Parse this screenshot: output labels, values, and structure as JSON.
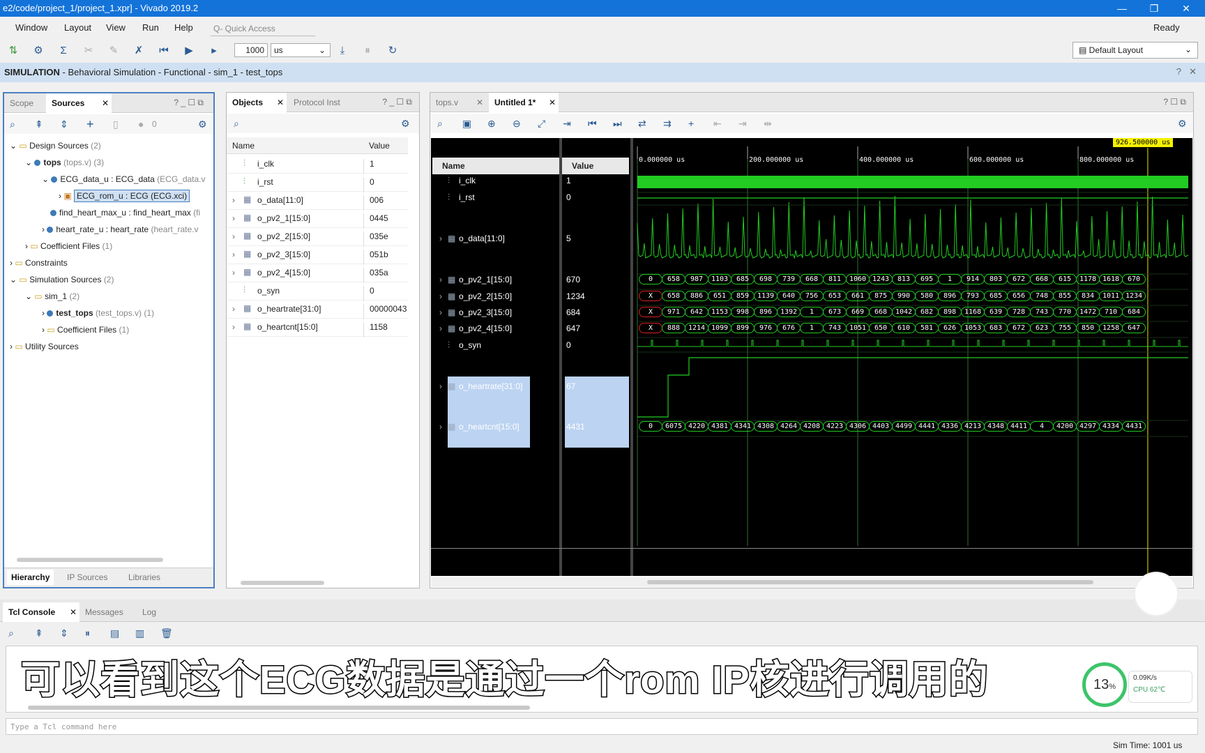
{
  "window": {
    "title": "e2/code/project_1/project_1.xpr] - Vivado 2019.2",
    "controls": [
      "—",
      "❐",
      "✕"
    ]
  },
  "menu": {
    "items": [
      "Window",
      "Layout",
      "View",
      "Run",
      "Help"
    ],
    "quick_access_placeholder": "Q- Quick Access",
    "status": "Ready"
  },
  "toolbar": {
    "time_value": "1000",
    "time_unit": "us",
    "layout": "Default Layout"
  },
  "sim_header": {
    "bold": "SIMULATION",
    "rest": " - Behavioral Simulation - Functional - sim_1 - test_tops"
  },
  "sources": {
    "tabs": [
      "Scope",
      "Sources"
    ],
    "badge": "0",
    "tree": [
      {
        "label": "Design Sources",
        "extra": "(2)"
      },
      {
        "label": "tops",
        "extra": "(tops.v) (3)"
      },
      {
        "label": "ECG_data_u : ECG_data",
        "extra": "(ECG_data.v"
      },
      {
        "label": "ECG_rom_u : ECG (ECG.xci)",
        "extra": ""
      },
      {
        "label": "find_heart_max_u : find_heart_max",
        "extra": "(fi"
      },
      {
        "label": "heart_rate_u : heart_rate",
        "extra": "(heart_rate.v"
      },
      {
        "label": "Coefficient Files",
        "extra": "(1)"
      },
      {
        "label": "Constraints",
        "extra": ""
      },
      {
        "label": "Simulation Sources",
        "extra": "(2)"
      },
      {
        "label": "sim_1",
        "extra": "(2)"
      },
      {
        "label": "test_tops",
        "extra": "(test_tops.v) (1)"
      },
      {
        "label": "Coefficient Files",
        "extra": "(1)"
      },
      {
        "label": "Utility Sources",
        "extra": ""
      }
    ],
    "bottom_tabs": [
      "Hierarchy",
      "IP Sources",
      "Libraries"
    ]
  },
  "objects": {
    "tabs": [
      "Objects",
      "Protocol Inst"
    ],
    "headers": [
      "Name",
      "Value"
    ],
    "rows": [
      {
        "name": "i_clk",
        "value": "1"
      },
      {
        "name": "i_rst",
        "value": "0"
      },
      {
        "name": "o_data[11:0]",
        "value": "006"
      },
      {
        "name": "o_pv2_1[15:0]",
        "value": "0445"
      },
      {
        "name": "o_pv2_2[15:0]",
        "value": "035e"
      },
      {
        "name": "o_pv2_3[15:0]",
        "value": "051b"
      },
      {
        "name": "o_pv2_4[15:0]",
        "value": "035a"
      },
      {
        "name": "o_syn",
        "value": "0"
      },
      {
        "name": "o_heartrate[31:0]",
        "value": "00000043"
      },
      {
        "name": "o_heartcnt[15:0]",
        "value": "1158"
      }
    ]
  },
  "wave": {
    "tabs": [
      "tops.v",
      "Untitled 1*"
    ],
    "headers": [
      "Name",
      "Value"
    ],
    "cursor": "926.500000 us",
    "ticks": [
      "0.000000 us",
      "200.000000 us",
      "400.000000 us",
      "600.000000 us",
      "800.000000 us"
    ],
    "signals": [
      {
        "name": "i_clk",
        "value": "1"
      },
      {
        "name": "i_rst",
        "value": "0"
      },
      {
        "name": "o_data[11:0]",
        "value": "5"
      },
      {
        "name": "o_pv2_1[15:0]",
        "value": "670"
      },
      {
        "name": "o_pv2_2[15:0]",
        "value": "1234"
      },
      {
        "name": "o_pv2_3[15:0]",
        "value": "684"
      },
      {
        "name": "o_pv2_4[15:0]",
        "value": "647"
      },
      {
        "name": "o_syn",
        "value": "0"
      },
      {
        "name": "o_heartrate[31:0]",
        "value": "67"
      },
      {
        "name": "o_heartcnt[15:0]",
        "value": "4431"
      }
    ],
    "buses": {
      "pv2_1": [
        "0",
        "658",
        "987",
        "1103",
        "685",
        "698",
        "739",
        "668",
        "811",
        "1060",
        "1243",
        "813",
        "695",
        "1",
        "914",
        "803",
        "672",
        "668",
        "615",
        "1178",
        "1618",
        "670"
      ],
      "pv2_2": [
        "X",
        "658",
        "886",
        "651",
        "859",
        "1139",
        "640",
        "756",
        "653",
        "661",
        "875",
        "990",
        "580",
        "896",
        "793",
        "685",
        "656",
        "748",
        "855",
        "834",
        "1011",
        "1234"
      ],
      "pv2_3": [
        "X",
        "971",
        "642",
        "1153",
        "998",
        "896",
        "1392",
        "1",
        "673",
        "669",
        "668",
        "1042",
        "682",
        "898",
        "1168",
        "639",
        "728",
        "743",
        "770",
        "1472",
        "710",
        "684"
      ],
      "pv2_4": [
        "X",
        "888",
        "1214",
        "1099",
        "899",
        "976",
        "676",
        "1",
        "743",
        "1051",
        "650",
        "610",
        "581",
        "626",
        "1053",
        "683",
        "672",
        "623",
        "755",
        "850",
        "1258",
        "647"
      ],
      "heartcnt": [
        "0",
        "6075",
        "4220",
        "4381",
        "4341",
        "4308",
        "4264",
        "4208",
        "4223",
        "4306",
        "4403",
        "4499",
        "4441",
        "4336",
        "4213",
        "4348",
        "4411",
        "4",
        "4200",
        "4297",
        "4334",
        "4431"
      ]
    }
  },
  "console": {
    "tabs": [
      "Tcl Console",
      "Messages",
      "Log"
    ],
    "input_placeholder": "Type a Tcl command here",
    "sim_time": "Sim Time: 1001 us"
  },
  "subtitle": "可以看到这个ECG数据是通过一个rom IP核进行调用的",
  "monitor": {
    "cpu_pct": "13",
    "net": "0.09K/s",
    "cpu_temp": "CPU 62℃"
  },
  "colors": {
    "titlebar": "#1373d9",
    "sim_header": "#cfe0f3",
    "wave_green": "#22cc22",
    "cursor": "#e8e800"
  }
}
